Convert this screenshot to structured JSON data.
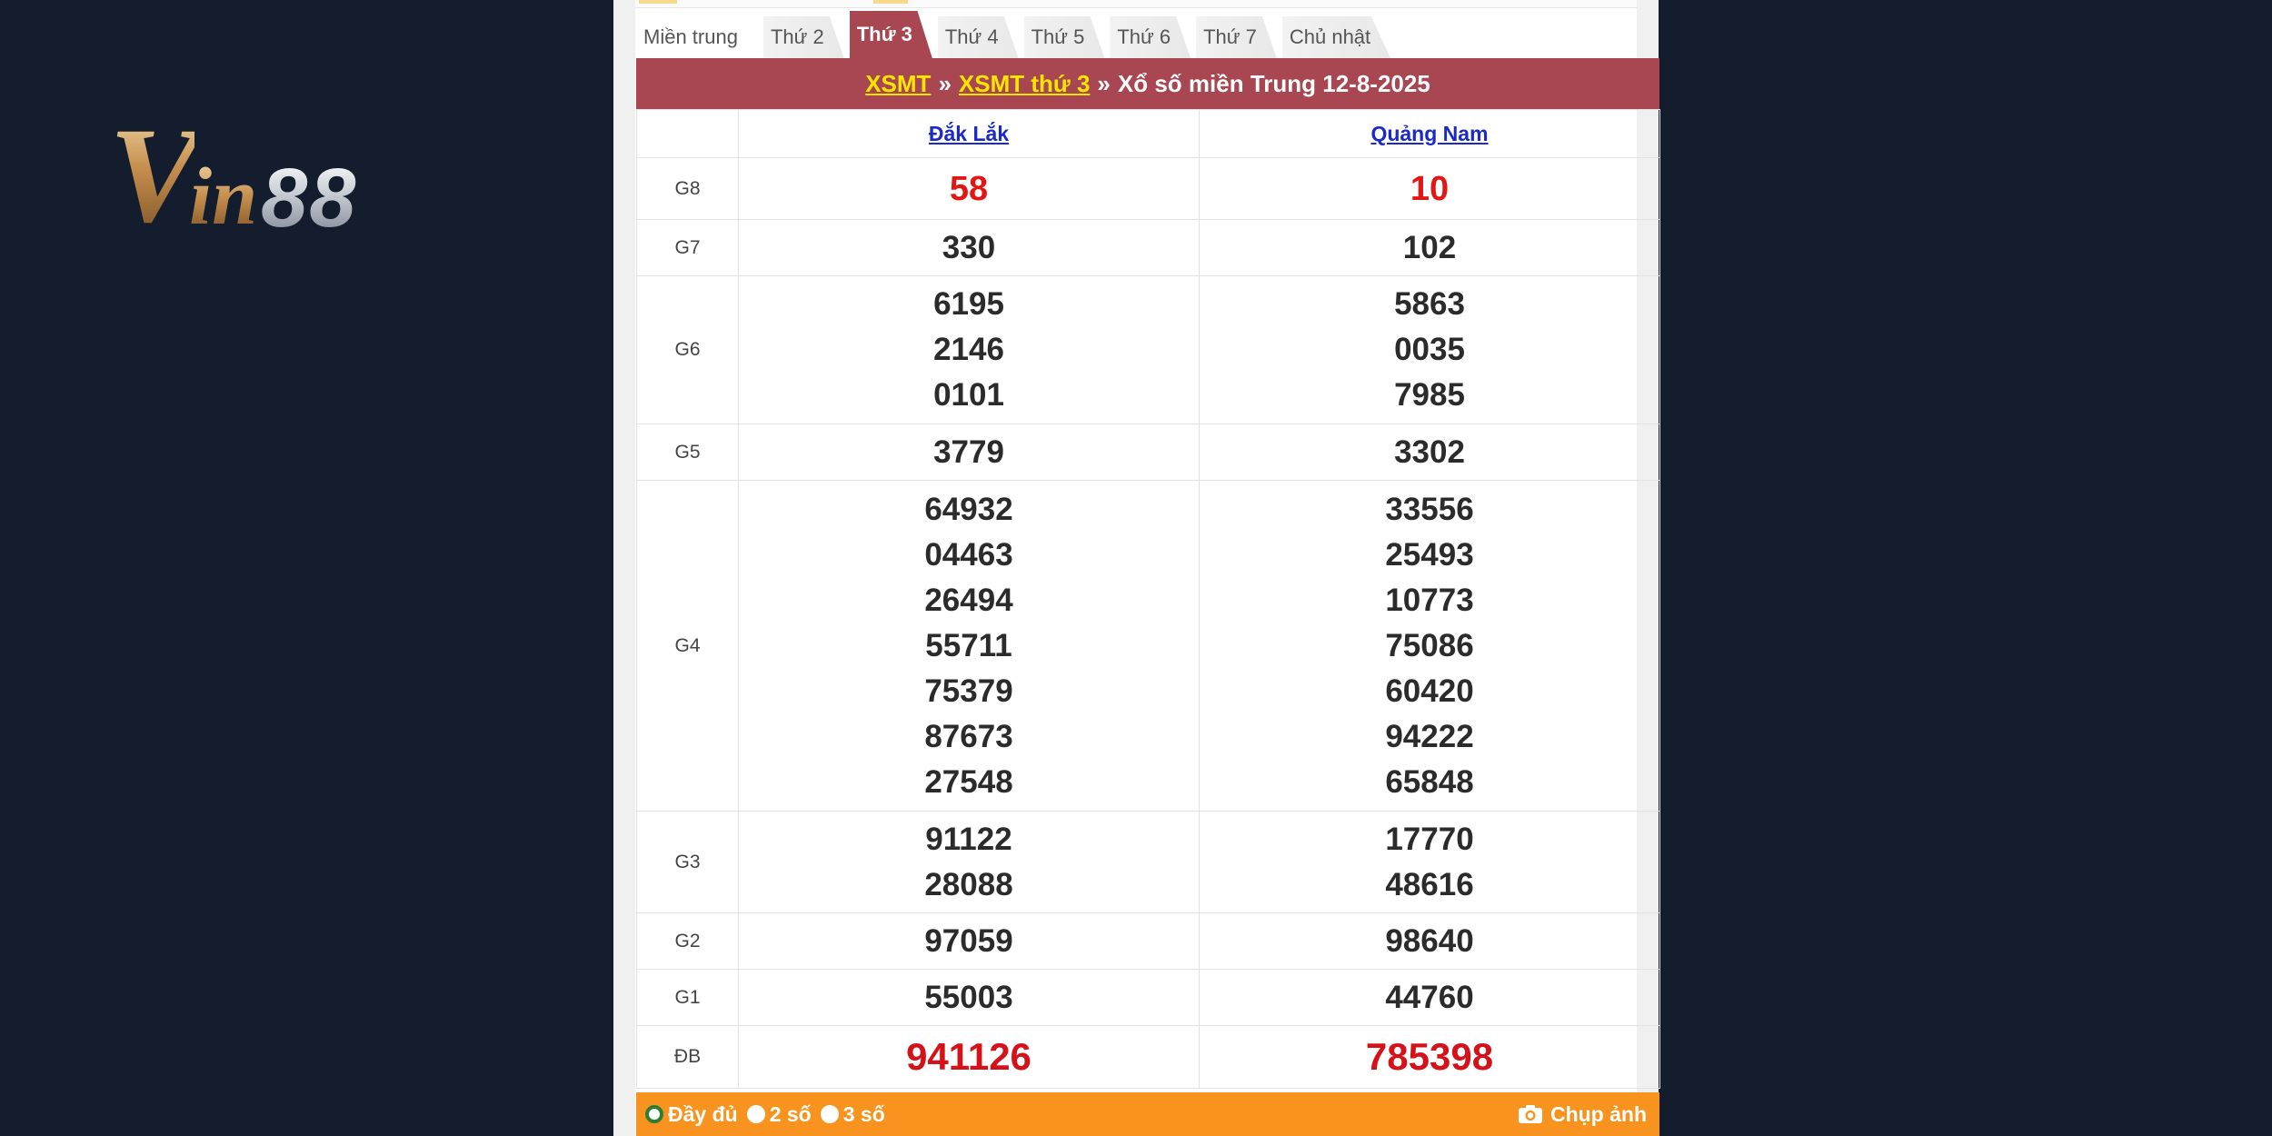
{
  "logo": {
    "v": "V",
    "in": "in",
    "num": "88"
  },
  "tabs": [
    {
      "label": "Miền trung",
      "active": false
    },
    {
      "label": "Thứ 2",
      "active": false
    },
    {
      "label": "Thứ 3",
      "active": true
    },
    {
      "label": "Thứ 4",
      "active": false
    },
    {
      "label": "Thứ 5",
      "active": false
    },
    {
      "label": "Thứ 6",
      "active": false
    },
    {
      "label": "Thứ 7",
      "active": false
    },
    {
      "label": "Chủ nhật",
      "active": false
    }
  ],
  "breadcrumb": {
    "link1": "XSMT",
    "sep": "»",
    "link2": "XSMT thứ 3",
    "title": "Xổ số miền Trung 12-8-2025"
  },
  "provinces": [
    "Đắk Lắk",
    "Quảng Nam"
  ],
  "prizes": {
    "g8": {
      "label": "G8",
      "p1": [
        "58"
      ],
      "p2": [
        "10"
      ]
    },
    "g7": {
      "label": "G7",
      "p1": [
        "330"
      ],
      "p2": [
        "102"
      ]
    },
    "g6": {
      "label": "G6",
      "p1": [
        "6195",
        "2146",
        "0101"
      ],
      "p2": [
        "5863",
        "0035",
        "7985"
      ]
    },
    "g5": {
      "label": "G5",
      "p1": [
        "3779"
      ],
      "p2": [
        "3302"
      ]
    },
    "g4": {
      "label": "G4",
      "p1": [
        "64932",
        "04463",
        "26494",
        "55711",
        "75379",
        "87673",
        "27548"
      ],
      "p2": [
        "33556",
        "25493",
        "10773",
        "75086",
        "60420",
        "94222",
        "65848"
      ]
    },
    "g3": {
      "label": "G3",
      "p1": [
        "91122",
        "28088"
      ],
      "p2": [
        "17770",
        "48616"
      ]
    },
    "g2": {
      "label": "G2",
      "p1": [
        "97059"
      ],
      "p2": [
        "98640"
      ]
    },
    "g1": {
      "label": "G1",
      "p1": [
        "55003"
      ],
      "p2": [
        "44760"
      ]
    },
    "db": {
      "label": "ĐB",
      "p1": [
        "941126"
      ],
      "p2": [
        "785398"
      ]
    }
  },
  "footer": {
    "options": [
      "Đầy đủ",
      "2 số",
      "3 số"
    ],
    "selected": "Đầy đủ",
    "capture": "Chụp ảnh"
  },
  "colors": {
    "tab_active": "#a84752",
    "link_yellow": "#ffe600",
    "prize_red": "#e31616",
    "footer_orange": "#f7931e",
    "background": "#141d2d"
  }
}
